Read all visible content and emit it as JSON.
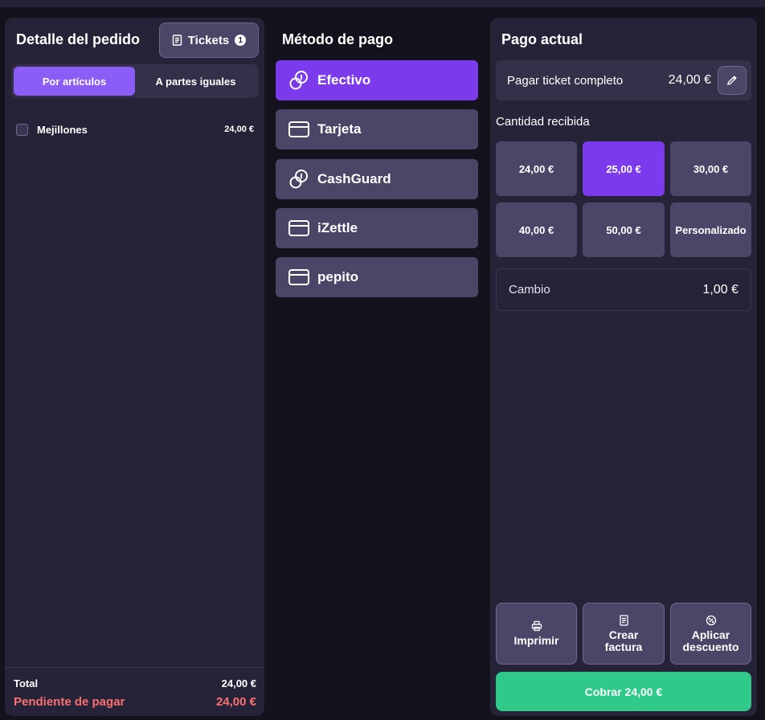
{
  "order": {
    "title": "Detalle del pedido",
    "tickets_label": "Tickets",
    "tickets_count": "1",
    "split_options": [
      "Por artículos",
      "A partes iguales"
    ],
    "items": [
      {
        "name": "Mejillones",
        "price": "24,00 €"
      }
    ],
    "total_label": "Total",
    "total_value": "24,00 €",
    "pending_label": "Pendiente de pagar",
    "pending_value": "24,00 €"
  },
  "payment_methods": {
    "title": "Método de pago",
    "items": [
      {
        "label": "Efectivo",
        "icon": "coins-icon"
      },
      {
        "label": "Tarjeta",
        "icon": "card-icon"
      },
      {
        "label": "CashGuard",
        "icon": "coins-icon"
      },
      {
        "label": "iZettle",
        "icon": "card-icon"
      },
      {
        "label": "pepito",
        "icon": "card-icon"
      }
    ],
    "selected": "Efectivo"
  },
  "current_payment": {
    "title": "Pago actual",
    "full_ticket_label": "Pagar ticket completo",
    "full_ticket_amount": "24,00 €",
    "received_label": "Cantidad recibida",
    "amounts": [
      "24,00 €",
      "25,00 €",
      "30,00 €",
      "40,00 €",
      "50,00 €",
      "Personalizado"
    ],
    "selected_amount": "25,00 €",
    "change_label": "Cambio",
    "change_value": "1,00 €",
    "actions": {
      "print": "Imprimir",
      "invoice_line1": "Crear",
      "invoice_line2": "factura",
      "discount_line1": "Aplicar",
      "discount_line2": "descuento"
    },
    "pay_button": "Cobrar 24,00 €"
  },
  "colors": {
    "accent": "#7c3aed",
    "pay": "#2fc98a",
    "pending": "#f87171",
    "panel": "#262338",
    "button": "#4b4668"
  }
}
